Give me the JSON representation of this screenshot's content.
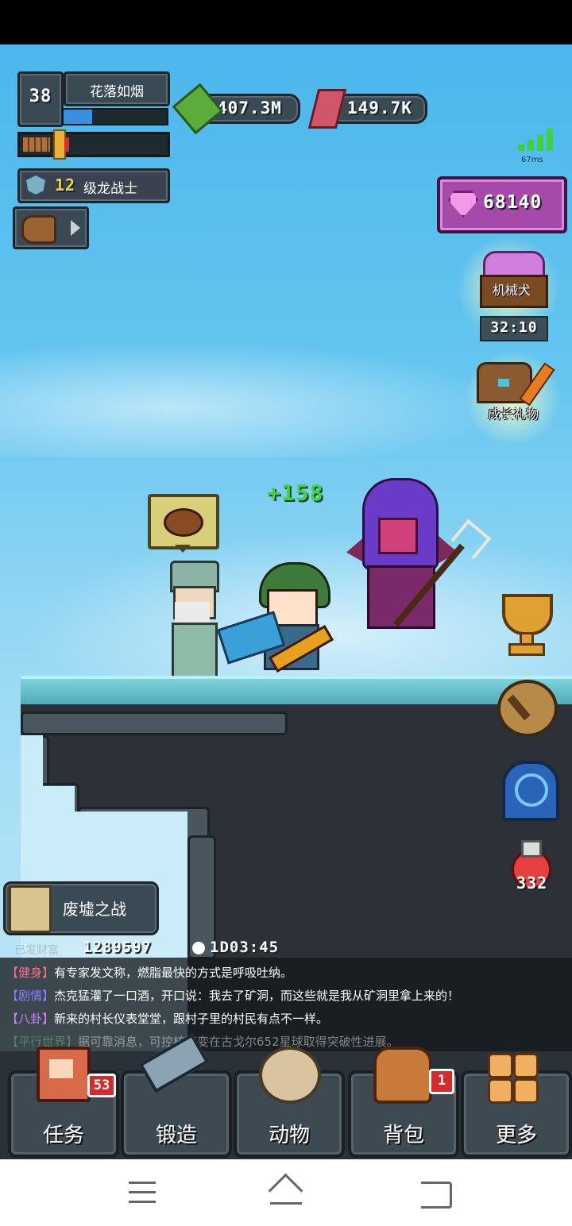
{
  "player": {
    "level": "38",
    "name": "花落如烟",
    "title_level": "12",
    "title_name": "级龙战士"
  },
  "currency": {
    "cash": "407.3M",
    "gems": "149.7K",
    "premium": "68140"
  },
  "network": {
    "ping": "67ms"
  },
  "side": {
    "mech_dog_label": "机械犬",
    "mech_dog_timer": "32:10",
    "growth_gift_label": "成长礼物",
    "potion_count": "332"
  },
  "battle": {
    "damage_popup": "+158"
  },
  "stage": {
    "name": "废墟之战",
    "score_label": "已发财富",
    "score": "1289597",
    "timer": "1D03:45"
  },
  "chat": [
    {
      "tag": "【健身】",
      "text": "有专家发文称，燃脂最快的方式是呼吸吐纳。"
    },
    {
      "tag": "【剧情】",
      "text": "杰克猛灌了一口酒，开口说：我去了矿洞，而这些就是我从矿洞里拿上来的！"
    },
    {
      "tag": "【八卦】",
      "text": "新来的村长仪表堂堂，跟村子里的村民有点不一样。"
    },
    {
      "tag": "【平行世界】",
      "text": "据可靠消息，可控核聚变在古戈尔652星球取得突破性进展。"
    }
  ],
  "nav": {
    "tasks": "任务",
    "tasks_badge": "53",
    "forge": "锻造",
    "animals": "动物",
    "bag": "背包",
    "bag_badge": "1",
    "more": "更多"
  },
  "colors": {
    "sky_top": "#4bb7ec",
    "panel": "#3a4a54",
    "badge_red": "#d82a2a",
    "premium_panel": "#a54aa8",
    "damage_green": "#3fd24a"
  }
}
